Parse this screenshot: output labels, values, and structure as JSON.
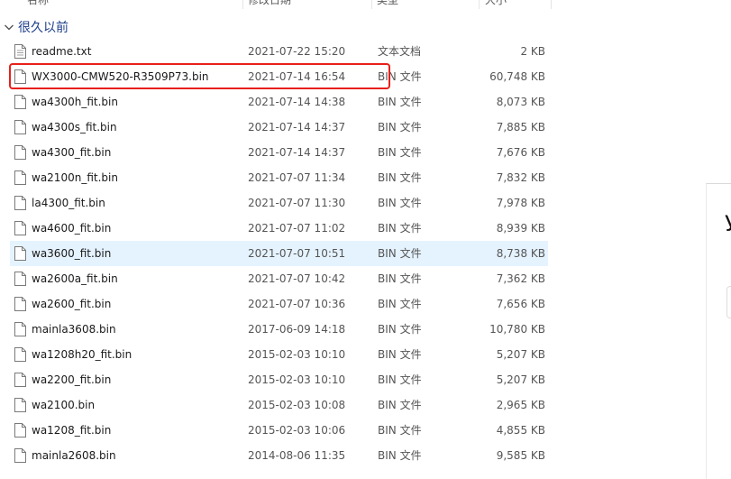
{
  "columns": {
    "name": "名称",
    "date": "修改日期",
    "type": "类型",
    "size": "大小"
  },
  "group": {
    "label": "很久以前"
  },
  "files": [
    {
      "name": "readme.txt",
      "date": "2021-07-22 15:20",
      "type": "文本文档",
      "size": "2 KB"
    },
    {
      "name": "WX3000-CMW520-R3509P73.bin",
      "date": "2021-07-14 16:54",
      "type": "BIN 文件",
      "size": "60,748 KB"
    },
    {
      "name": "wa4300h_fit.bin",
      "date": "2021-07-14 14:38",
      "type": "BIN 文件",
      "size": "8,073 KB"
    },
    {
      "name": "wa4300s_fit.bin",
      "date": "2021-07-14 14:37",
      "type": "BIN 文件",
      "size": "7,885 KB"
    },
    {
      "name": "wa4300_fit.bin",
      "date": "2021-07-14 14:37",
      "type": "BIN 文件",
      "size": "7,676 KB"
    },
    {
      "name": "wa2100n_fit.bin",
      "date": "2021-07-07 11:34",
      "type": "BIN 文件",
      "size": "7,832 KB"
    },
    {
      "name": "la4300_fit.bin",
      "date": "2021-07-07 11:30",
      "type": "BIN 文件",
      "size": "7,978 KB"
    },
    {
      "name": "wa4600_fit.bin",
      "date": "2021-07-07 11:02",
      "type": "BIN 文件",
      "size": "8,939 KB"
    },
    {
      "name": "wa3600_fit.bin",
      "date": "2021-07-07 10:51",
      "type": "BIN 文件",
      "size": "8,738 KB"
    },
    {
      "name": "wa2600a_fit.bin",
      "date": "2021-07-07 10:42",
      "type": "BIN 文件",
      "size": "7,362 KB"
    },
    {
      "name": "wa2600_fit.bin",
      "date": "2021-07-07 10:36",
      "type": "BIN 文件",
      "size": "7,656 KB"
    },
    {
      "name": "mainla3608.bin",
      "date": "2017-06-09 14:18",
      "type": "BIN 文件",
      "size": "10,780 KB"
    },
    {
      "name": "wa1208h20_fit.bin",
      "date": "2015-02-03 10:10",
      "type": "BIN 文件",
      "size": "5,207 KB"
    },
    {
      "name": "wa2200_fit.bin",
      "date": "2015-02-03 10:10",
      "type": "BIN 文件",
      "size": "5,207 KB"
    },
    {
      "name": "wa2100.bin",
      "date": "2015-02-03 10:08",
      "type": "BIN 文件",
      "size": "2,965 KB"
    },
    {
      "name": "wa1208_fit.bin",
      "date": "2015-02-03 10:06",
      "type": "BIN 文件",
      "size": "4,855 KB"
    },
    {
      "name": "mainla2608.bin",
      "date": "2014-08-06 11:35",
      "type": "BIN 文件",
      "size": "9,585 KB"
    }
  ],
  "selected_index": 8,
  "highlighted_index": 1,
  "highlight_color": "#e8201a",
  "selection_color": "#e5f3ff",
  "group_color": "#1e3f8a",
  "right_panel": {
    "glyph": "У"
  }
}
